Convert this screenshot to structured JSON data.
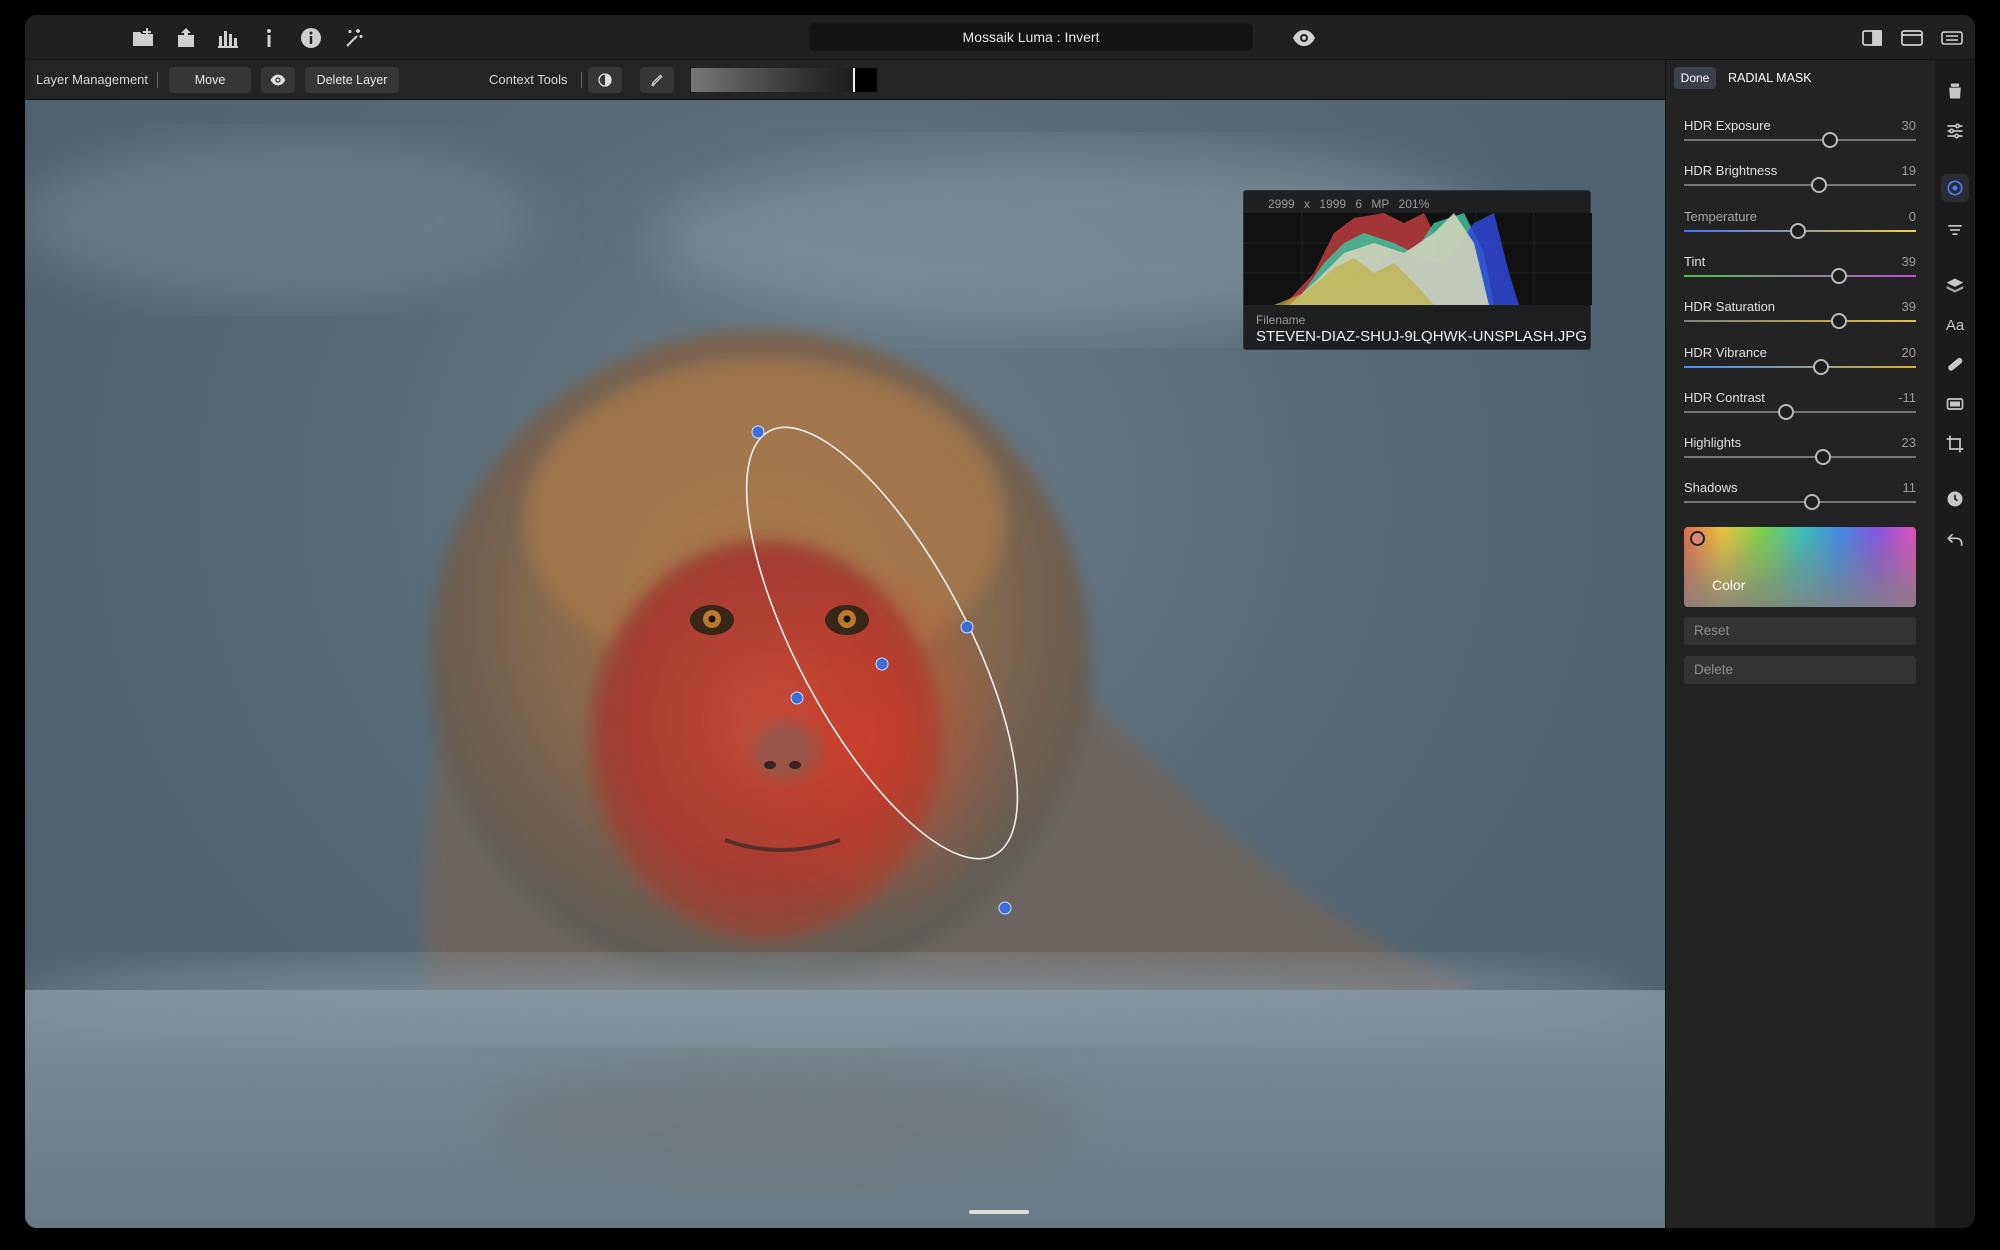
{
  "window": {
    "title": "Mossaik Luma : Invert"
  },
  "titlebar": {
    "left_icons": [
      "open-folder-icon",
      "export-icon",
      "histogram-icon",
      "info-icon",
      "info-circle-icon",
      "magic-wand-icon"
    ],
    "center_icons": [
      "eye-icon"
    ],
    "right_icons": [
      "sidebar-toggle-icon",
      "window-icon",
      "keyboard-icon"
    ]
  },
  "toolbar": {
    "layer_management_label": "Layer Management",
    "move_layer_label": "Move Layer",
    "delete_layer_label": "Delete Layer",
    "context_tools_label": "Context Tools"
  },
  "histogram": {
    "dimensions": "2999 x 1999",
    "megapixels": "6 MP",
    "zoom": "201%",
    "filename_label": "Filename",
    "filename": "STEVEN-DIAZ-SHUJ-9LQHWK-UNSPLASH.JPG"
  },
  "panel": {
    "done_label": "Done",
    "mask_title": "RADIAL MASK",
    "sliders": [
      {
        "label": "HDR Exposure",
        "value": "30",
        "position": 0.63,
        "track": [
          "#777777",
          "#777777"
        ],
        "dim": false
      },
      {
        "label": "HDR Brightness",
        "value": "19",
        "position": 0.58,
        "track": [
          "#777777",
          "#777777"
        ],
        "dim": false
      },
      {
        "label": "Temperature",
        "value": "0",
        "position": 0.49,
        "track": [
          "#4a6cf0",
          "#e8d040"
        ],
        "dim": true
      },
      {
        "label": "Tint",
        "value": "39",
        "position": 0.67,
        "track": [
          "#50c050",
          "#c050d8"
        ],
        "dim": false
      },
      {
        "label": "HDR Saturation",
        "value": "39",
        "position": 0.67,
        "track": [
          "#808080",
          "#e0c040"
        ],
        "dim": false
      },
      {
        "label": "HDR Vibrance",
        "value": "20",
        "position": 0.59,
        "track": [
          "#4a8cf0",
          "#d0b040"
        ],
        "dim": false
      },
      {
        "label": "HDR Contrast",
        "value": "-11",
        "position": 0.44,
        "track": [
          "#777777",
          "#777777"
        ],
        "dim": false
      },
      {
        "label": "Highlights",
        "value": "23",
        "position": 0.6,
        "track": [
          "#777777",
          "#777777"
        ],
        "dim": false
      },
      {
        "label": "Shadows",
        "value": "11",
        "position": 0.55,
        "track": [
          "#777777",
          "#777777"
        ],
        "dim": false
      }
    ],
    "color_label": "Color",
    "reset_label": "Reset",
    "delete_label": "Delete"
  },
  "side_icons": [
    "bucket-icon",
    "adjustments-icon",
    "radial-mask-icon",
    "filter-icon",
    "layers-icon",
    "text-icon",
    "healing-icon",
    "frame-icon",
    "crop-icon",
    "history-icon",
    "undo-icon"
  ],
  "side_text_icon": "Aa",
  "colors": {
    "accent": "#4f7cf6",
    "handle": "#3a6fd8"
  }
}
